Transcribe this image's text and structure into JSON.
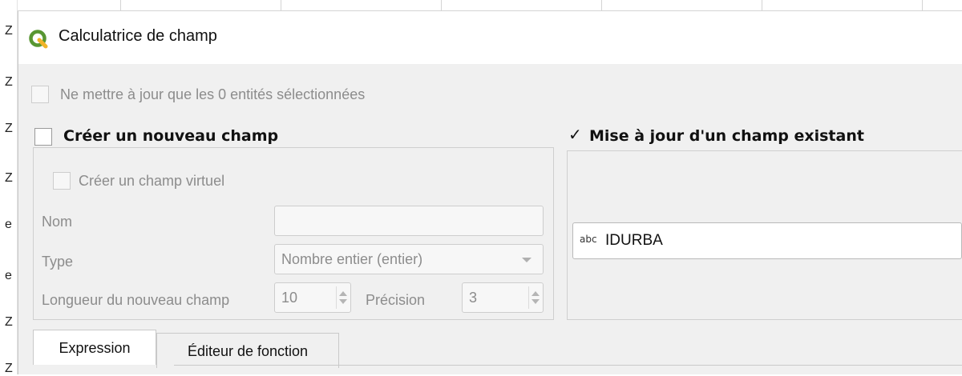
{
  "background": {
    "left_chars": [
      "Z",
      "Z",
      "Z",
      "Z",
      "e",
      "e",
      "Z",
      "Z"
    ]
  },
  "window": {
    "title": "Calculatrice de champ",
    "icon": "qgis-logo-icon",
    "accent": "#589632"
  },
  "selection_only": {
    "label": "Ne mettre à jour que les 0 entités sélectionnées",
    "checked": false,
    "enabled": false
  },
  "new_field": {
    "label": "Créer un nouveau champ",
    "checked": false,
    "virtual": {
      "label": "Créer un champ virtuel",
      "checked": false
    },
    "name": {
      "label": "Nom",
      "value": ""
    },
    "type": {
      "label": "Type",
      "value": "Nombre entier (entier)"
    },
    "length": {
      "label": "Longueur du nouveau champ",
      "value": "10"
    },
    "precision": {
      "label": "Précision",
      "value": "3"
    }
  },
  "update_field": {
    "check_mark": "✓",
    "label": "Mise à jour d'un champ existant",
    "checked": true,
    "field_type_badge": "abc",
    "field_value": "IDURBA"
  },
  "tabs": [
    {
      "label": "Expression",
      "active": true
    },
    {
      "label": "Éditeur de fonction",
      "active": false
    }
  ]
}
